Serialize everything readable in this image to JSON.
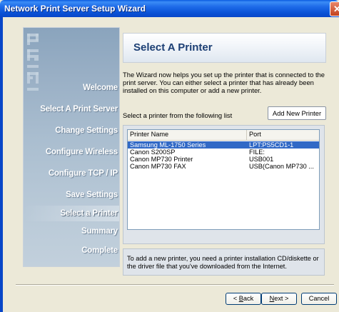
{
  "window": {
    "title": "Network Print Server Setup Wizard",
    "close_glyph": "✕"
  },
  "steps": [
    "Welcome",
    "Select A Print Server",
    "Change Settings",
    "Configure Wireless",
    "Configure TCP / IP",
    "Save Settings",
    "Select a Printer",
    "Summary",
    "Complete"
  ],
  "active_step": "Select a Printer",
  "page": {
    "title": "Select A Printer",
    "intro": "The Wizard now helps you set up the printer that is connected to the print server. You can either select a printer that has already been installed on this computer or add a new printer.",
    "list_label": "Select a printer from the following list",
    "add_button": "Add New Printer",
    "hint": "To add a new printer, you need a printer installation CD/diskette or the driver file that you've downloaded from the Internet."
  },
  "printer_list": {
    "columns": [
      "Printer Name",
      "Port"
    ],
    "rows": [
      {
        "name": "Samsung ML-1750 Series",
        "port": "LPT:PS5CD1-1",
        "selected": true
      },
      {
        "name": "Canon S200SP",
        "port": "FILE:",
        "selected": false
      },
      {
        "name": "Canon MP730 Printer",
        "port": "USB001",
        "selected": false
      },
      {
        "name": "Canon MP730 FAX",
        "port": "USB(Canon MP730 ...",
        "selected": false
      }
    ]
  },
  "buttons": {
    "back_prefix": "< ",
    "back_key": "B",
    "back_rest": "ack",
    "next_key": "N",
    "next_rest": "ext >",
    "cancel": "Cancel"
  },
  "colors": {
    "selection": "#3169c6",
    "title_bar": "#0a52d6",
    "header_title": "#1c3f74"
  }
}
